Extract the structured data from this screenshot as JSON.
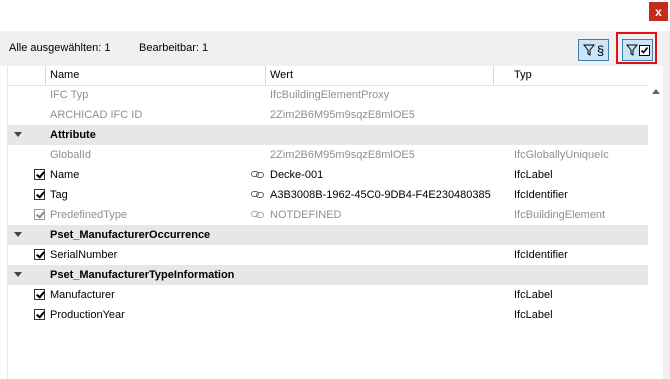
{
  "window": {
    "close_glyph": "x"
  },
  "toolbar": {
    "selected_all": "Alle ausgewählten: 1",
    "editable": "Bearbeitbar: 1",
    "filter_properties_glyph": "§",
    "filter_checked_icon": "filter-checkbox-icon"
  },
  "columns": {
    "name": "Name",
    "value": "Wert",
    "type": "Typ"
  },
  "rows": {
    "r0": {
      "name": "IFC Typ",
      "value": "IfcBuildingElementProxy",
      "type": ""
    },
    "r1": {
      "name": "ARCHICAD IFC ID",
      "value": "2Zim2B6M95m9sqzE8mlOE5",
      "type": ""
    },
    "r2": {
      "name": "Attribute"
    },
    "r3": {
      "name": "GlobalId",
      "value": "2Zim2B6M95m9sqzE8mlOE5",
      "type": "IfcGloballyUniqueIc"
    },
    "r4": {
      "name": "Name",
      "value": "Decke-001",
      "type": "IfcLabel"
    },
    "r5": {
      "name": "Tag",
      "value": "A3B3008B-1962-45C0-9DB4-F4E230480385",
      "type": "IfcIdentifier"
    },
    "r6": {
      "name": "PredefinedType",
      "value": "NOTDEFINED",
      "type": "IfcBuildingElement"
    },
    "r7": {
      "name": "Pset_ManufacturerOccurrence"
    },
    "r8": {
      "name": "SerialNumber",
      "value": "",
      "type": "IfcIdentifier"
    },
    "r9": {
      "name": "Pset_ManufacturerTypeInformation"
    },
    "r10": {
      "name": "Manufacturer",
      "value": "",
      "type": "IfcLabel"
    },
    "r11": {
      "name": "ProductionYear",
      "value": "",
      "type": "IfcLabel"
    }
  },
  "colors": {
    "accent": "#cce4f7",
    "accent_border": "#3c7fb1",
    "highlight": "#e0101a",
    "section_bg": "#e7e7e7",
    "muted_text": "#8f8f8f",
    "close_bg": "#c42b1c"
  }
}
